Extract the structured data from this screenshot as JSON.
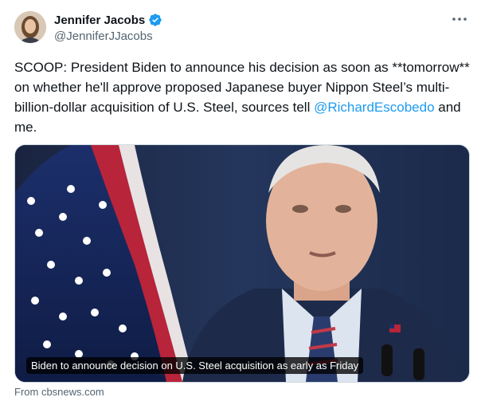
{
  "author": {
    "name": "Jennifer Jacobs",
    "handle": "@JenniferJJacobs",
    "verified": true,
    "verified_color": "#1d9bf0"
  },
  "tweet": {
    "text_before": "SCOOP: President Biden to announce his decision as soon as **tomorrow** on whether he'll approve proposed Japanese buyer Nippon Steel’s multi-billion-dollar acquisition of U.S. Steel, sources tell ",
    "mention": "@RichardEscobedo",
    "text_after": " and me."
  },
  "card": {
    "caption": "Biden to announce decision on U.S. Steel acquisition as early as Friday",
    "source": "From cbsnews.com"
  },
  "icons": {
    "more": "more-horizontal-icon",
    "verified": "verified-badge-icon"
  }
}
